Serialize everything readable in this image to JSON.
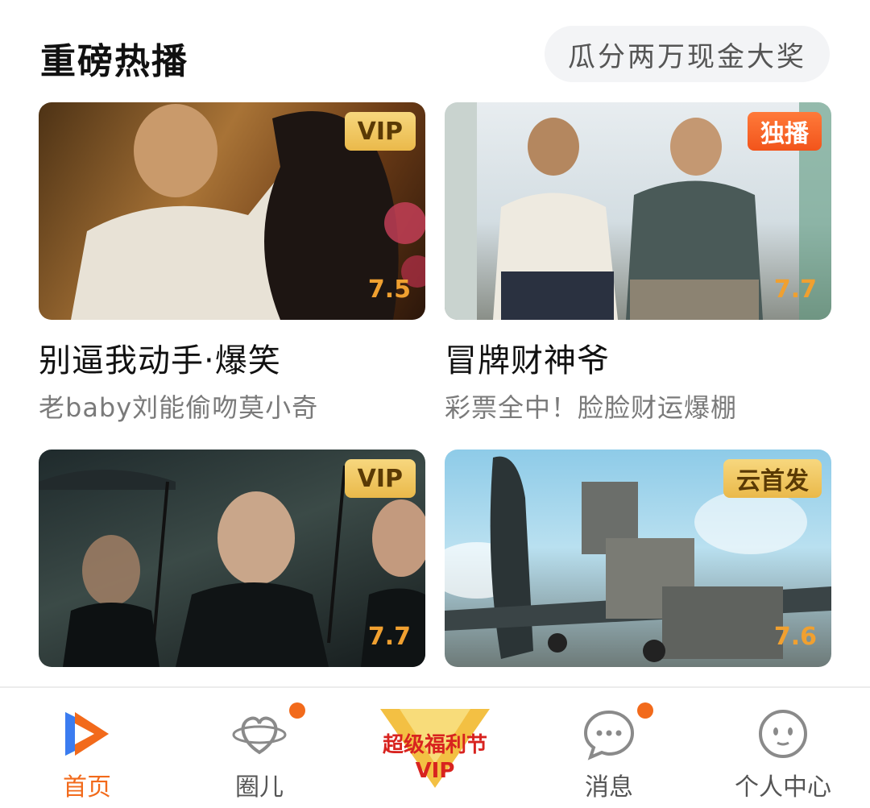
{
  "header": {
    "title": "重磅热播",
    "promo": "瓜分两万现金大奖"
  },
  "cards": [
    {
      "title": "别逼我动手·爆笑",
      "subtitle": "老baby刘能偷吻莫小奇",
      "badge": "VIP",
      "score": "7.5"
    },
    {
      "title": "冒牌财神爷",
      "subtitle": "彩票全中！脸脸财运爆棚",
      "badge": "独播",
      "score": "7.7"
    },
    {
      "title": "",
      "subtitle": "",
      "badge": "VIP",
      "score": "7.7"
    },
    {
      "title": "",
      "subtitle": "",
      "badge": "云首发",
      "score": "7.6"
    }
  ],
  "nav": {
    "items": [
      {
        "label": "首页",
        "active": true
      },
      {
        "label": "圈儿"
      },
      {
        "label": "超级福利节",
        "sub": "VIP"
      },
      {
        "label": "消息"
      },
      {
        "label": "个人中心"
      }
    ]
  },
  "colors": {
    "accent": "#f26a1b",
    "vip_gold": "#eab94a",
    "score": "#f0a030"
  }
}
